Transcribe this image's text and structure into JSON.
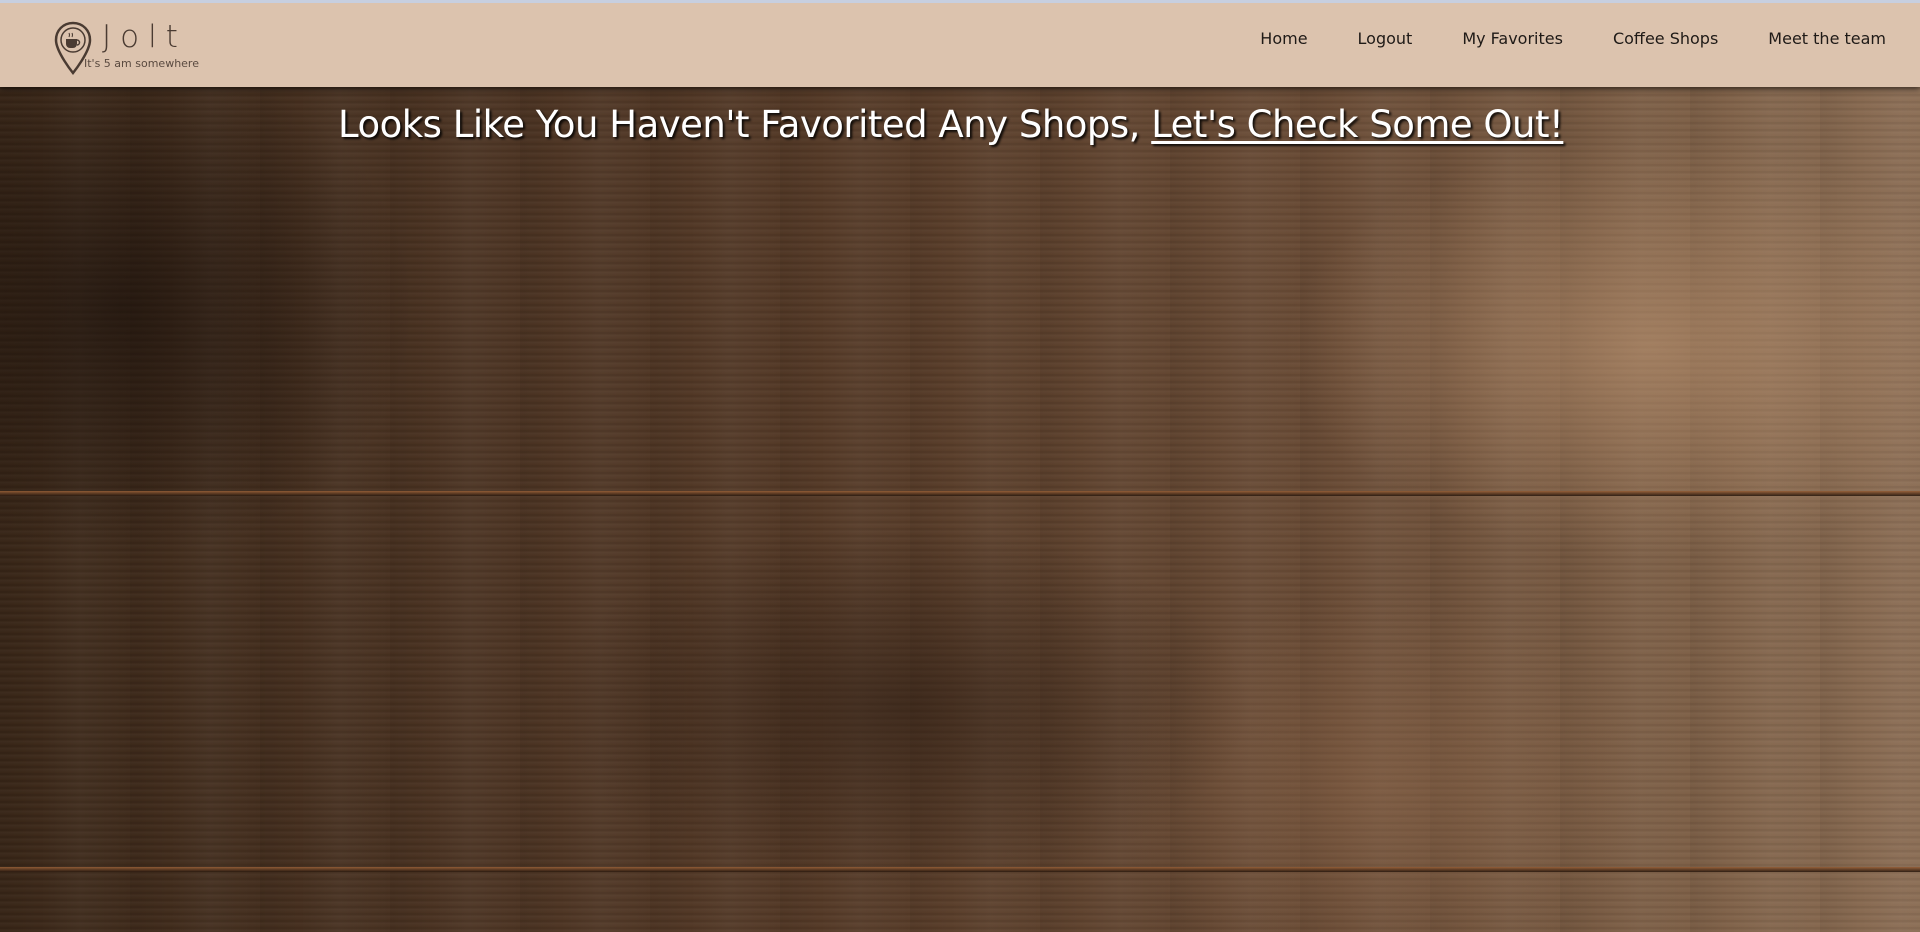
{
  "brand": {
    "name": "Jolt",
    "tagline": "It's 5 am somewhere",
    "pin_color": "#4a3b32"
  },
  "nav": {
    "items": [
      {
        "label": "Home"
      },
      {
        "label": "Logout"
      },
      {
        "label": "My Favorites"
      },
      {
        "label": "Coffee Shops"
      },
      {
        "label": "Meet the team"
      }
    ]
  },
  "hero": {
    "message": "Looks Like You Haven't Favorited Any Shops, ",
    "link_text": "Let's Check Some Out!",
    "background": "wood-plank-texture"
  },
  "colors": {
    "navbar_bg": "#dcc3ae",
    "nav_text": "#1f1a17",
    "hero_text": "#ffffff"
  }
}
